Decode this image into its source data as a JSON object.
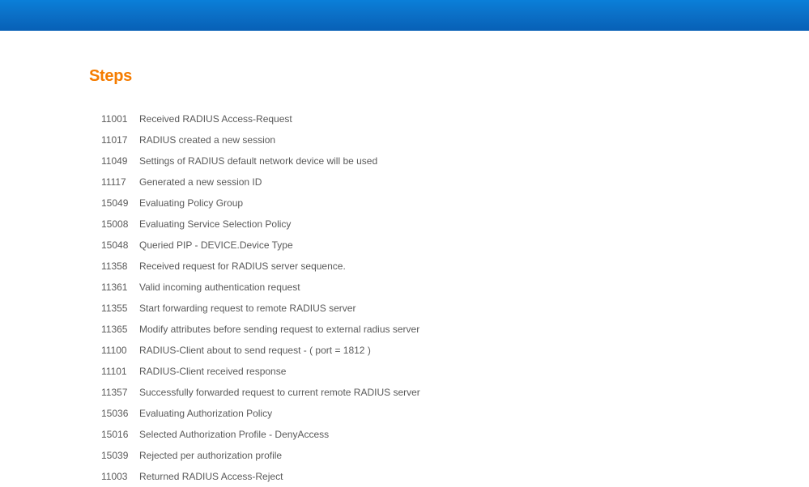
{
  "section": {
    "title": "Steps"
  },
  "steps": [
    {
      "code": "11001",
      "desc": "Received RADIUS Access-Request"
    },
    {
      "code": "11017",
      "desc": "RADIUS created a new session"
    },
    {
      "code": "11049",
      "desc": "Settings of RADIUS default network device will be used"
    },
    {
      "code": "11117",
      "desc": "Generated a new session ID"
    },
    {
      "code": "15049",
      "desc": "Evaluating Policy Group"
    },
    {
      "code": "15008",
      "desc": "Evaluating Service Selection Policy"
    },
    {
      "code": "15048",
      "desc": "Queried PIP - DEVICE.Device Type"
    },
    {
      "code": "11358",
      "desc": "Received request for RADIUS server sequence."
    },
    {
      "code": "11361",
      "desc": "Valid incoming authentication request"
    },
    {
      "code": "11355",
      "desc": "Start forwarding request to remote RADIUS server"
    },
    {
      "code": "11365",
      "desc": "Modify attributes before sending request to external radius server"
    },
    {
      "code": "11100",
      "desc": "RADIUS-Client about to send request - ( port = 1812 )"
    },
    {
      "code": "11101",
      "desc": "RADIUS-Client received response"
    },
    {
      "code": "11357",
      "desc": "Successfully forwarded request to current remote RADIUS server"
    },
    {
      "code": "15036",
      "desc": "Evaluating Authorization Policy"
    },
    {
      "code": "15016",
      "desc": "Selected Authorization Profile - DenyAccess"
    },
    {
      "code": "15039",
      "desc": "Rejected per authorization profile"
    },
    {
      "code": "11003",
      "desc": "Returned RADIUS Access-Reject"
    }
  ]
}
